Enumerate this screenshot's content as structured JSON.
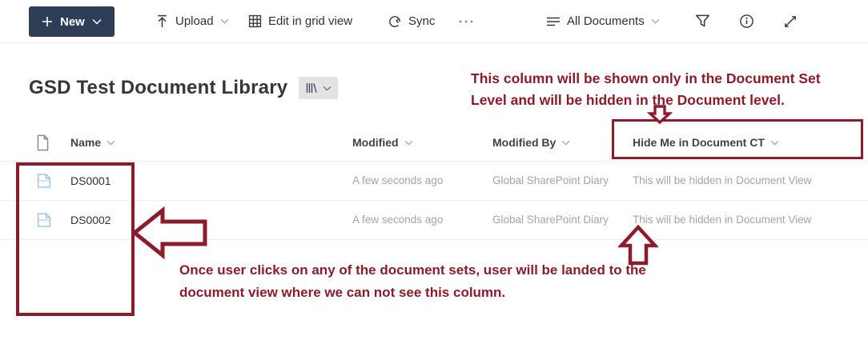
{
  "toolbar": {
    "new_label": "New",
    "upload_label": "Upload",
    "edit_grid_label": "Edit in grid view",
    "sync_label": "Sync",
    "view_selector_label": "All Documents"
  },
  "header": {
    "title": "GSD Test Document Library"
  },
  "table": {
    "columns": {
      "name": "Name",
      "modified": "Modified",
      "modified_by": "Modified By",
      "hide_me": "Hide Me in Document CT"
    },
    "rows": [
      {
        "name": "DS0001",
        "modified": "A few seconds ago",
        "modified_by": "Global SharePoint Diary",
        "hide_me": "This will be hidden in Document View"
      },
      {
        "name": "DS0002",
        "modified": "A few seconds ago",
        "modified_by": "Global SharePoint Diary",
        "hide_me": "This will be hidden in Document View"
      }
    ]
  },
  "annotations": {
    "top_line1": "This column will be shown only in the Document Set",
    "top_line2": "Level and will be hidden in the Document level.",
    "bottom_line1": "Once user clicks on any of the document sets, user will be landed to the",
    "bottom_line2": "document view where we can not see this column.",
    "annotation_color": "#8a1c2b"
  },
  "colors": {
    "new_button_bg": "#2e3e57",
    "annotation_maroon": "#8a1c2b",
    "muted_text": "#a6a4a2",
    "docset_icon_blue": "#9cc3e0"
  }
}
